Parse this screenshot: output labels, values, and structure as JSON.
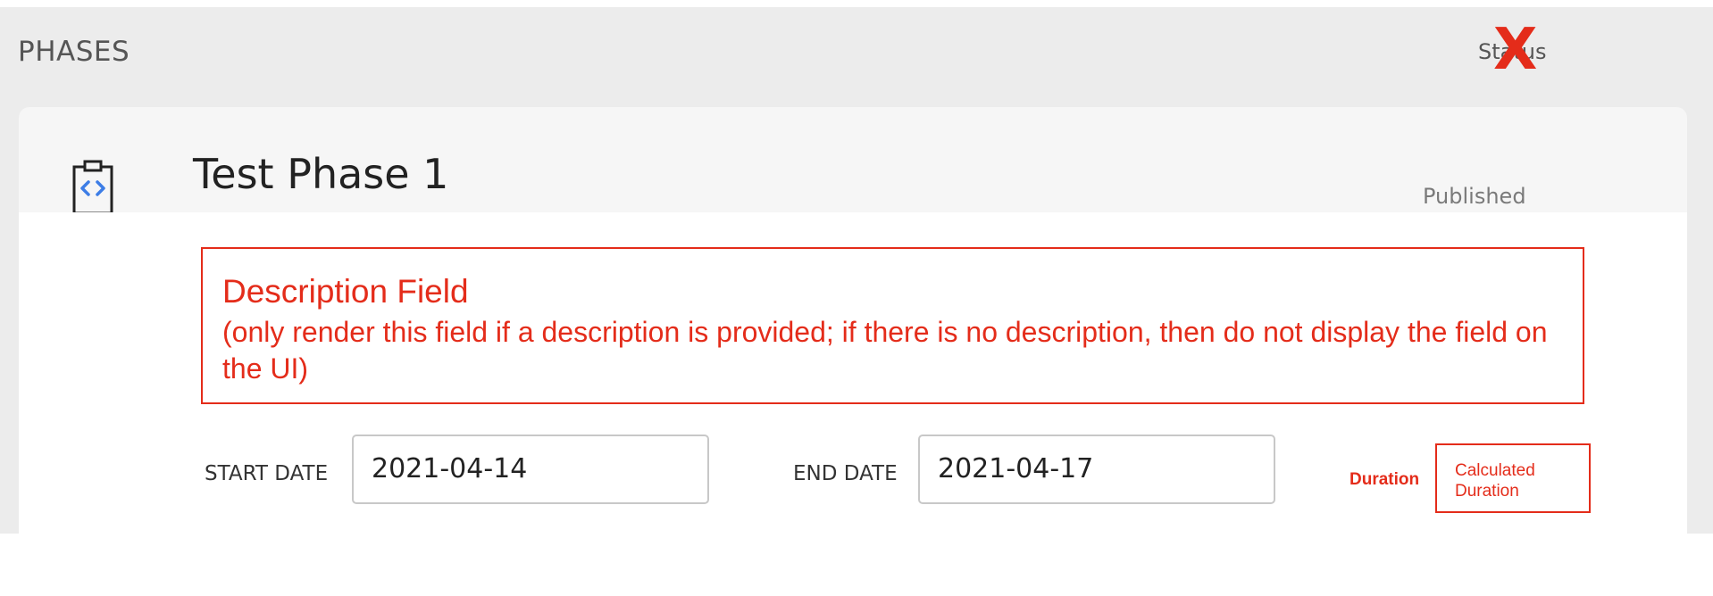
{
  "header": {
    "title": "PHASES",
    "status_column": "Status",
    "annotation_mark": "X"
  },
  "phase": {
    "name": "Test Phase 1",
    "status": "Published",
    "icon": "clipboard-code-icon"
  },
  "description_note": {
    "title": "Description Field",
    "text": "(only render this field if a description is provided; if there is no description, then do not display the field on the UI)"
  },
  "dates": {
    "start_label": "START DATE",
    "start_value": "2021-04-14",
    "end_label": "END DATE",
    "end_value": "2021-04-17"
  },
  "duration": {
    "label": "Duration",
    "value": "Calculated Duration"
  },
  "colors": {
    "annotation": "#e42c1a",
    "icon_accent": "#3d7de6",
    "header_background": "#ececec"
  }
}
